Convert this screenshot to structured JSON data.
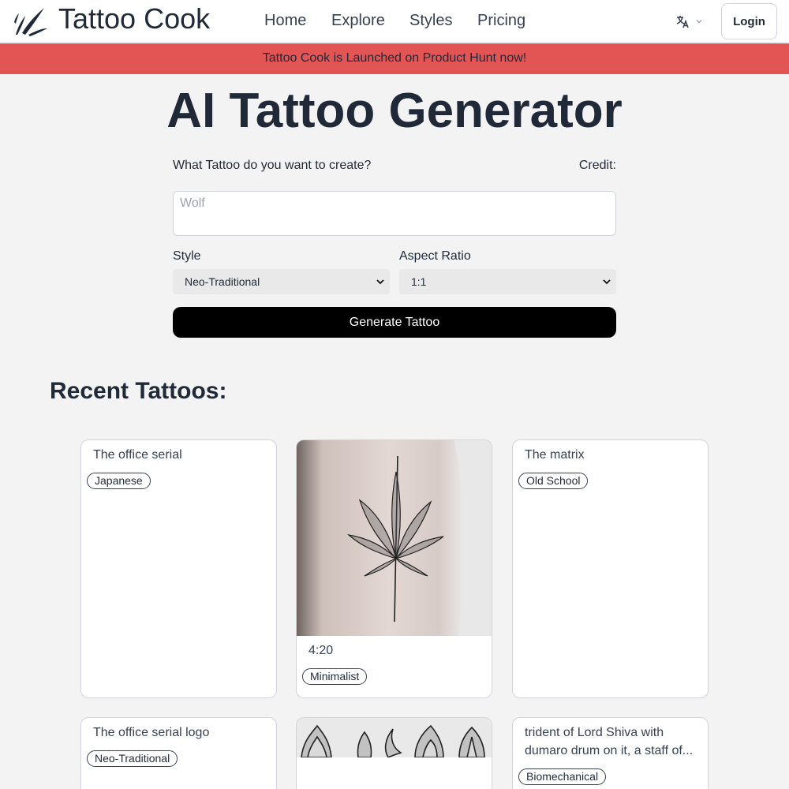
{
  "header": {
    "brand": "Tattoo Cook",
    "nav": [
      "Home",
      "Explore",
      "Styles",
      "Pricing"
    ],
    "language_icon": "translate-icon",
    "login_label": "Login"
  },
  "banner": {
    "text": "Tattoo Cook is Launched on Product Hunt now!"
  },
  "main": {
    "title": "AI Tattoo Generator",
    "prompt_label": "What Tattoo do you want to create?",
    "credit_label": "Credit:",
    "prompt_placeholder": "Wolf",
    "style_label": "Style",
    "style_value": "Neo-Traditional",
    "aspect_label": "Aspect Ratio",
    "aspect_value": "1:1",
    "generate_label": "Generate Tattoo"
  },
  "recent": {
    "title": "Recent Tattoos:",
    "cards": [
      {
        "title": "The office serial",
        "tag": "Japanese"
      },
      {
        "title": "4:20",
        "tag": "Minimalist"
      },
      {
        "title": "The matrix",
        "tag": "Old School"
      },
      {
        "title": "The office serial logo",
        "tag": "Neo-Traditional"
      },
      {
        "title": "",
        "tag": ""
      },
      {
        "title": "trident of Lord Shiva with dumaro drum on it, a staff of...",
        "tag": "Biomechanical"
      }
    ]
  }
}
